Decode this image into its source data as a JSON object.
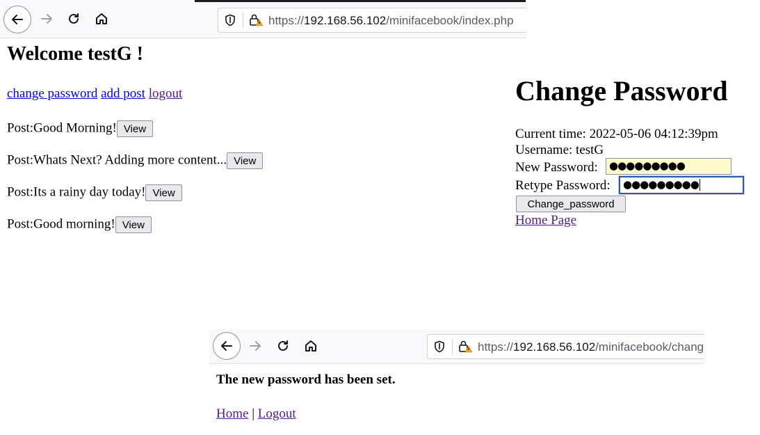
{
  "window1": {
    "url_prefix": "https://",
    "url_host": "192.168.56.102",
    "url_path": "/minifacebook/index.php"
  },
  "index_page": {
    "welcome": "Welcome testG !",
    "links": {
      "change_password": "change password",
      "add_post": "add post",
      "logout": "logout"
    },
    "posts": [
      {
        "text": "Post:Good Morning!",
        "button": "View"
      },
      {
        "text": "Post:Whats Next? Adding more content...",
        "button": "View"
      },
      {
        "text": "Post:Its a rainy day today!",
        "button": "View"
      },
      {
        "text": "Post:Good morning!",
        "button": "View"
      }
    ]
  },
  "change_password": {
    "title": "Change Password",
    "current_time_label": "Current time: 2022-05-06 04:12:39pm",
    "username_label": "Username: testG",
    "new_password_label": "New Password:",
    "new_password_value": "●●●●●●●●●",
    "retype_password_label": "Retype Password:",
    "retype_password_value": "●●●●●●●●●",
    "submit_label": "Change_password",
    "home_link": "Home Page"
  },
  "window2": {
    "url_prefix": "https://",
    "url_host": "192.168.56.102",
    "url_path": "/minifacebook/chang",
    "message": "The new password has been set.",
    "home_link": "Home",
    "separator": "|",
    "logout_link": "Logout"
  },
  "colors": {
    "link": "#0000ee",
    "visited_link": "#551a8b",
    "autofill_bg": "#fffacd",
    "focus_border": "#1f5fa8",
    "warning_lock": "#f5a623"
  }
}
